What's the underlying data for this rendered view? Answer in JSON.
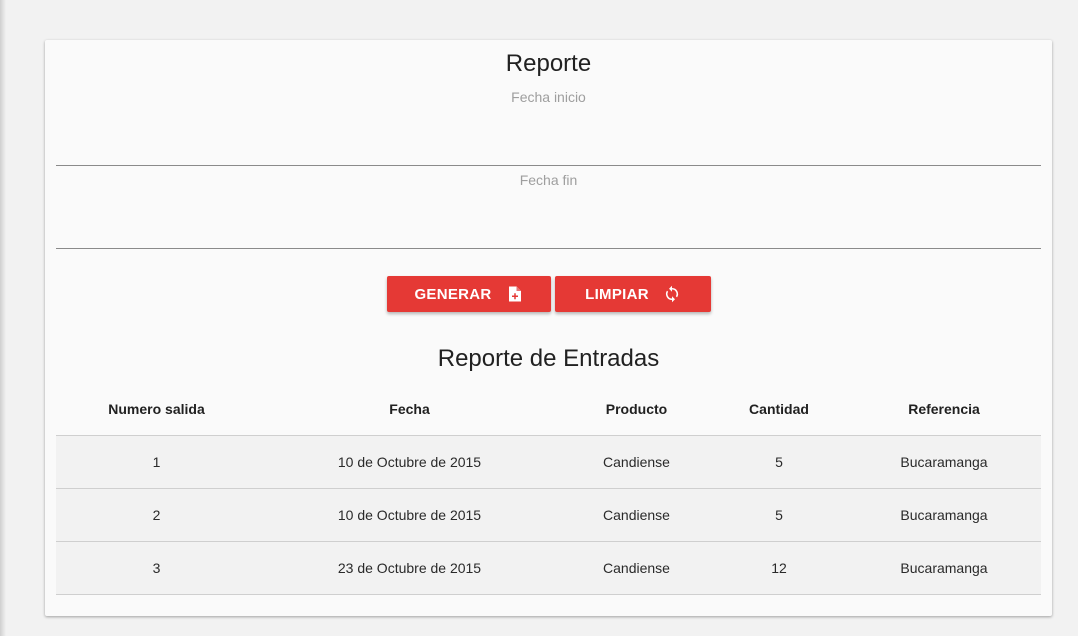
{
  "form": {
    "title": "Reporte",
    "fecha_inicio": {
      "label": "Fecha inicio",
      "value": ""
    },
    "fecha_fin": {
      "label": "Fecha fin",
      "value": ""
    },
    "buttons": {
      "generar": {
        "label": "GENERAR",
        "icon": "file-plus-icon"
      },
      "limpiar": {
        "label": "LIMPIAR",
        "icon": "refresh-icon"
      }
    }
  },
  "report": {
    "title": "Reporte de Entradas",
    "columns": [
      "Numero salida",
      "Fecha",
      "Producto",
      "Cantidad",
      "Referencia"
    ],
    "rows": [
      [
        "1",
        "10 de Octubre de 2015",
        "Candiense",
        "5",
        "Bucaramanga"
      ],
      [
        "2",
        "10 de Octubre de 2015",
        "Candiense",
        "5",
        "Bucaramanga"
      ],
      [
        "3",
        "23 de Octubre de 2015",
        "Candiense",
        "12",
        "Bucaramanga"
      ]
    ]
  },
  "colors": {
    "accent": "#e53935",
    "card_bg": "#fafafa",
    "page_bg": "#f2f2f2"
  }
}
